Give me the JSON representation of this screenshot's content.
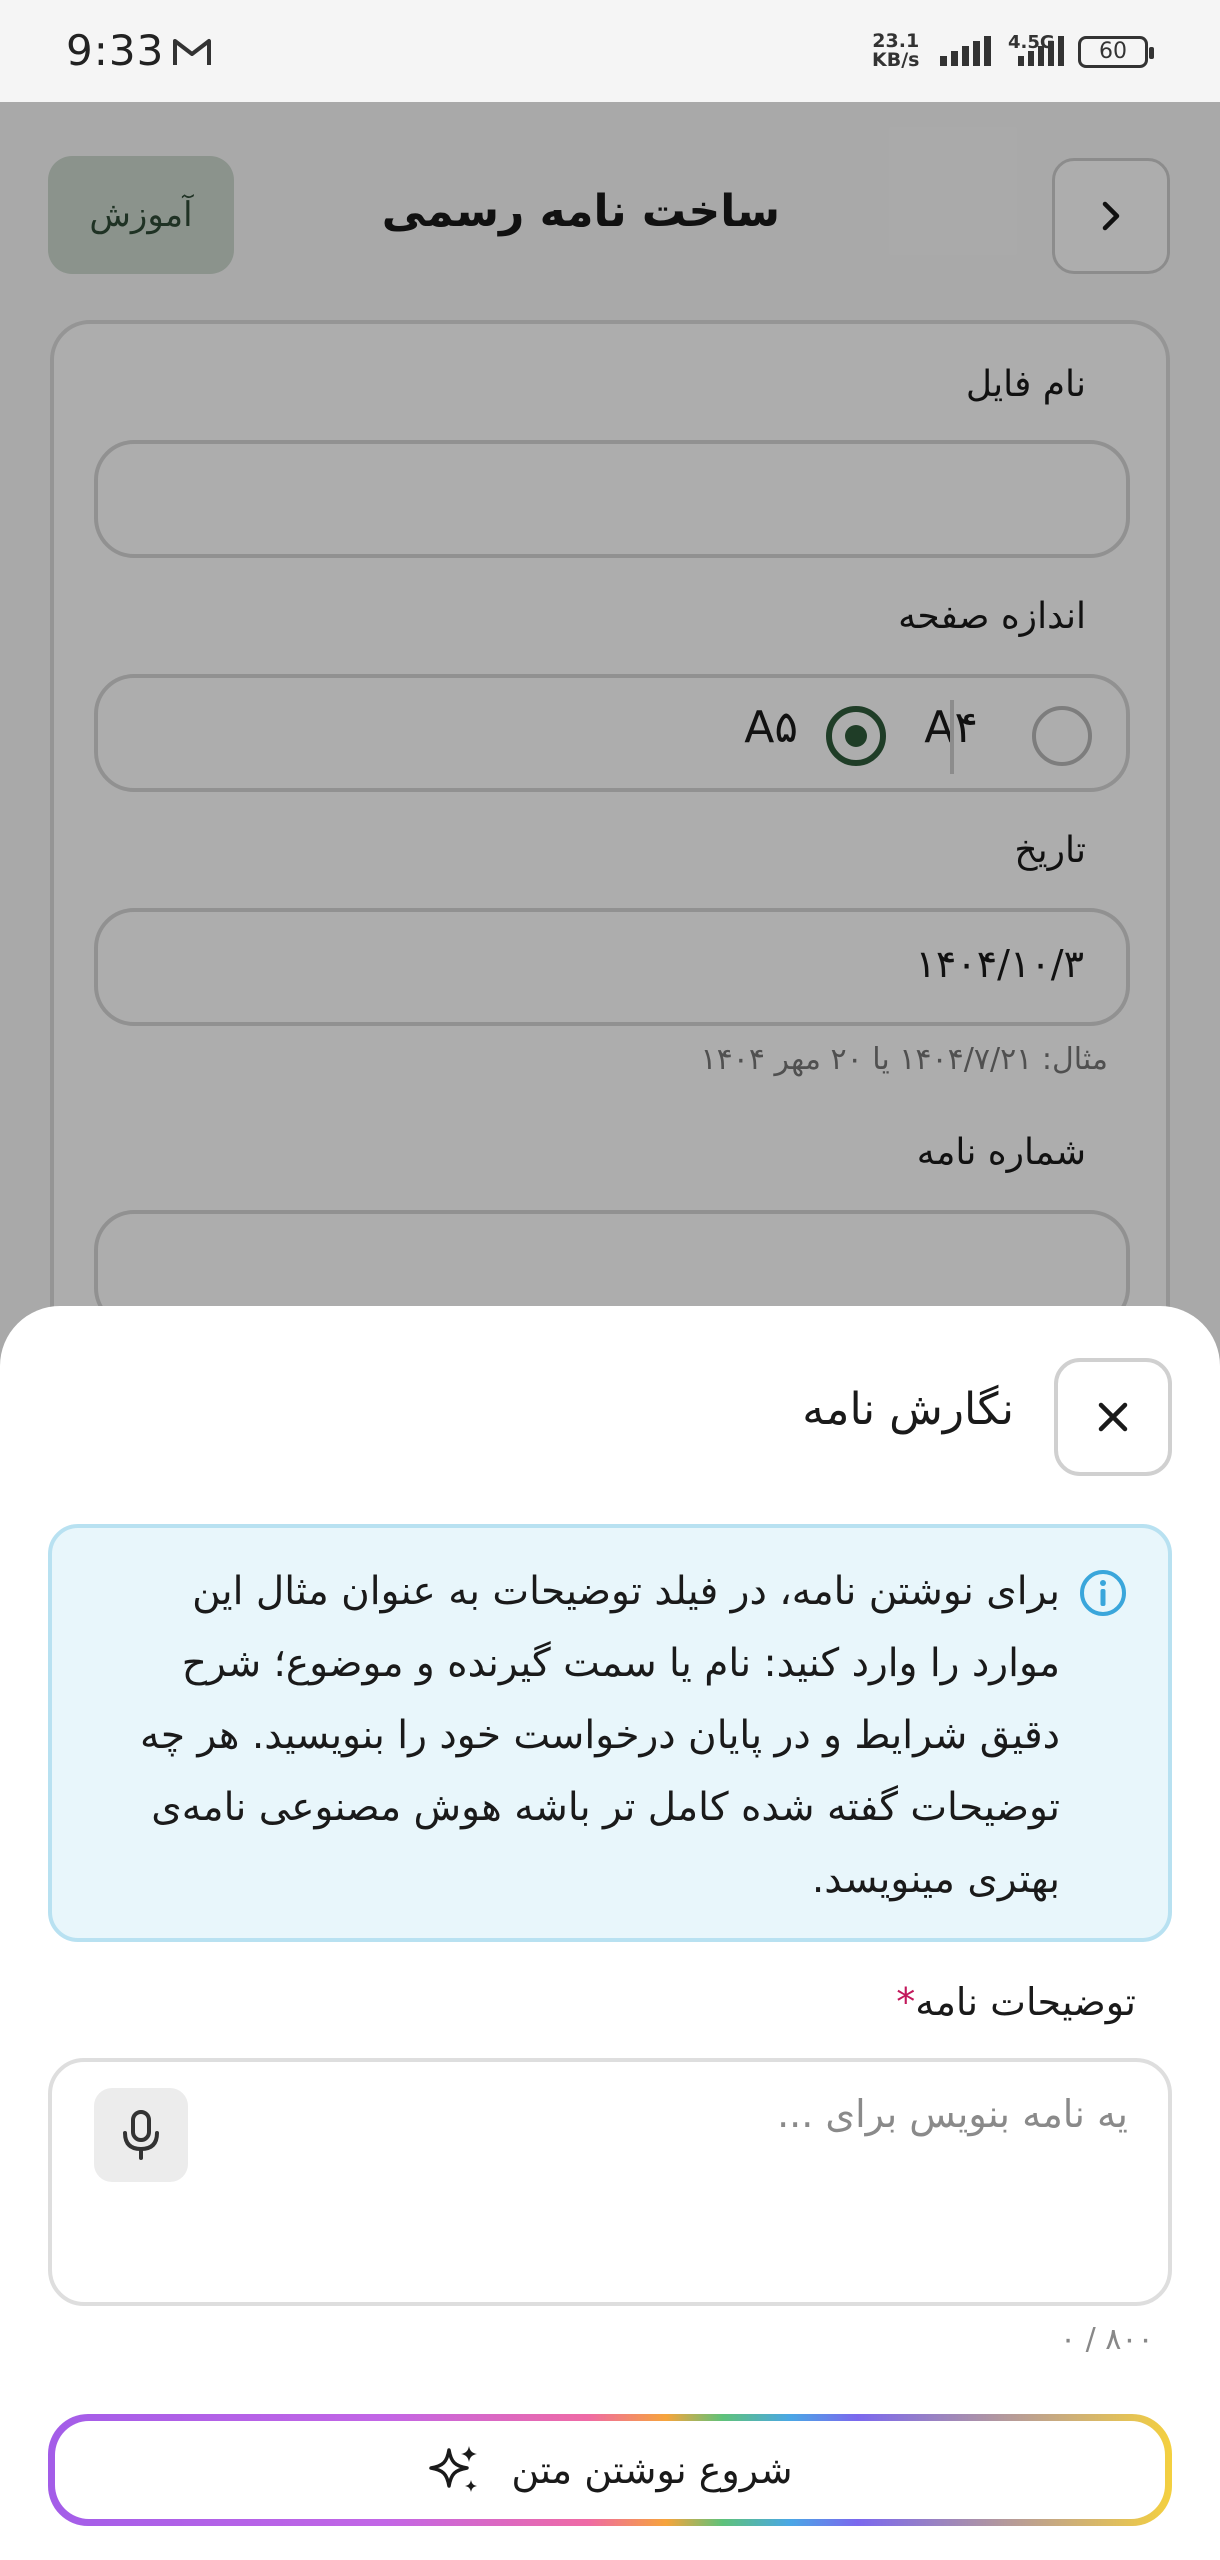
{
  "status_bar": {
    "time": "9:33",
    "speed_value": "23.1",
    "speed_unit": "KB/s",
    "network": "4.5G",
    "battery": "60"
  },
  "header": {
    "title": "ساخت نامه رسمی",
    "tutorial_label": "آموزش",
    "back_icon": "chevron-right-icon"
  },
  "form": {
    "file_name_label": "نام فایل",
    "file_name_value": "",
    "page_size_label": "اندازه صفحه",
    "page_size_options": [
      {
        "label": "A۴",
        "selected": false
      },
      {
        "label": "A۵",
        "selected": true
      }
    ],
    "date_label": "تاریخ",
    "date_value": "۱۴۰۴/۱۰/۳",
    "date_hint": "مثال: ۱۴۰۴/۷/۲۱ یا ۲۰ مهر ۱۴۰۴",
    "letter_number_label": "شماره نامه"
  },
  "sheet": {
    "title": "نگارش نامه",
    "info_text": "برای نوشتن نامه، در فیلد توضیحات به عنوان مثال این موارد را وارد کنید: نام یا سمت گیرنده و موضوع؛ شرح دقیق شرایط و در پایان درخواست خود را بنویسید. هر چه توضیحات گفته شده کامل تر باشه هوش مصنوعی نامه‌ی بهتری مینویسد.",
    "description_label": "توضیحات نامه",
    "required_mark": "*",
    "description_placeholder": "یه نامه بنویس برای ...",
    "counter": "۰ / ۸۰۰",
    "start_button_label": "شروع نوشتن متن"
  },
  "colors": {
    "accent_green": "#2f5a3a",
    "info_bg": "#e8f6fb",
    "info_border": "#b8e1f1",
    "required": "#c2185b"
  }
}
